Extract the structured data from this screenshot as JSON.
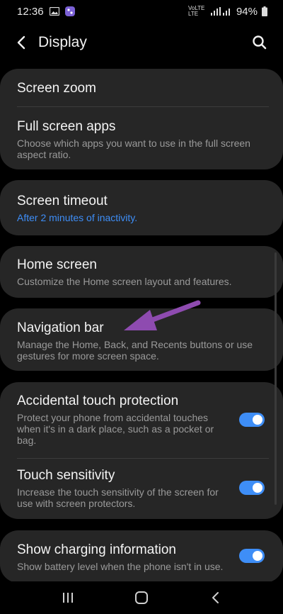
{
  "status_bar": {
    "time": "12:36",
    "network": "VoLTE LTE",
    "battery_percent": "94%",
    "icons": [
      "image-notification-icon",
      "app-notification-icon",
      "signal-icon",
      "battery-icon"
    ]
  },
  "header": {
    "back_icon": "chevron-left-icon",
    "title": "Display",
    "search_icon": "search-icon"
  },
  "settings": {
    "screen_zoom": {
      "title": "Screen zoom"
    },
    "full_screen_apps": {
      "title": "Full screen apps",
      "subtitle": "Choose which apps you want to use in the full screen aspect ratio."
    },
    "screen_timeout": {
      "title": "Screen timeout",
      "subtitle": "After 2 minutes of inactivity."
    },
    "home_screen": {
      "title": "Home screen",
      "subtitle": "Customize the Home screen layout and features."
    },
    "navigation_bar": {
      "title": "Navigation bar",
      "subtitle": "Manage the Home, Back, and Recents buttons or use gestures for more screen space."
    },
    "accidental_touch": {
      "title": "Accidental touch protection",
      "subtitle": "Protect your phone from accidental touches when it's in a dark place, such as a pocket or bag.",
      "enabled": true
    },
    "touch_sensitivity": {
      "title": "Touch sensitivity",
      "subtitle": "Increase the touch sensitivity of the screen for use with screen protectors.",
      "enabled": true
    },
    "charging_info": {
      "title": "Show charging information",
      "subtitle": "Show battery level when the phone isn't in use.",
      "enabled": true
    }
  },
  "annotation": {
    "arrow_color": "#8e4bb0"
  },
  "colors": {
    "accent": "#3e8ef7",
    "card": "#262626",
    "background": "#000000"
  },
  "nav_bar": {
    "icons": [
      "recents-icon",
      "home-icon",
      "back-icon"
    ]
  }
}
